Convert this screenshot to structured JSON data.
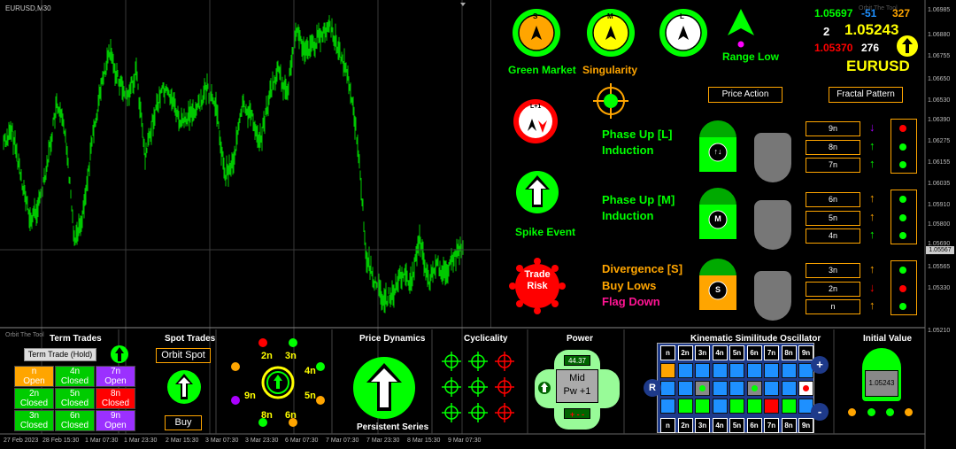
{
  "chart": {
    "symbol_tf": "EURUSD,M30",
    "price_ticks": [
      "1.06985",
      "1.06880",
      "1.06755",
      "1.06650",
      "1.06530",
      "1.06390",
      "1.06275",
      "1.06155",
      "1.06035",
      "1.05910",
      "1.05800",
      "1.05690",
      "1.05565",
      "1.05330",
      "1.05210"
    ],
    "current_price": "1.05567",
    "time_ticks": [
      "27 Feb 2023",
      "28 Feb 15:30",
      "1 Mar 07:30",
      "1 Mar 23:30",
      "2 Mar 15:30",
      "3 Mar 07:30",
      "3 Mar 23:30",
      "6 Mar 07:30",
      "7 Mar 07:30",
      "7 Mar 23:30",
      "8 Mar 15:30",
      "9 Mar 07:30"
    ]
  },
  "watermark": "Orbit The Tool",
  "watermark2": "Orbit The Tool",
  "top_circles": [
    {
      "letter": "S",
      "label": "Green Market",
      "label_color": "#00ff00",
      "fill": "#ffa500",
      "ring": "#00ff00"
    },
    {
      "letter": "M",
      "label": "Singularity",
      "label_color": "#ffa500",
      "fill": "#ffff00",
      "ring": "#00ff00"
    },
    {
      "letter": "L",
      "label": "",
      "label_color": "#00ff00",
      "fill": "#ffffff",
      "ring": "#00ff00"
    }
  ],
  "range_low": {
    "label": "Range Low"
  },
  "stats": {
    "v1": "1.05697",
    "v2": "-51",
    "v3": "327",
    "v4": "2",
    "v5": "1.05243",
    "v6": "1.05370",
    "v7": "276",
    "symbol": "EURUSD"
  },
  "price_action_btn": "Price Action",
  "fractal_btn": "Fractal Pattern",
  "lhl_badge": "L+1",
  "spike_label": "Spike Event",
  "trade_risk": "Trade Risk",
  "phase_l": {
    "line1": "Phase Up [L]",
    "line2": "Induction"
  },
  "phase_m": {
    "line1": "Phase Up [M]",
    "line2": "Induction"
  },
  "divergence": {
    "line1": "Divergence [S]",
    "line2": "Buy Lows",
    "line3": "Flag Down"
  },
  "tiles": [
    {
      "symbol": "↑↓"
    },
    {
      "symbol": "M"
    },
    {
      "symbol": "S"
    }
  ],
  "fractal_rows": [
    {
      "label": "9n",
      "arrow": "↓",
      "arrow_color": "#aa00ff",
      "dot": "#ff0000"
    },
    {
      "label": "8n",
      "arrow": "↑",
      "arrow_color": "#00ff00",
      "dot": "#00ff00"
    },
    {
      "label": "7n",
      "arrow": "↑",
      "arrow_color": "#00ff00",
      "dot": "#00ff00"
    },
    {
      "label": "6n",
      "arrow": "↑",
      "arrow_color": "#ffa500",
      "dot": "#00ff00"
    },
    {
      "label": "5n",
      "arrow": "↑",
      "arrow_color": "#ffa500",
      "dot": "#00ff00"
    },
    {
      "label": "4n",
      "arrow": "↑",
      "arrow_color": "#00ff00",
      "dot": "#00ff00"
    },
    {
      "label": "3n",
      "arrow": "↑",
      "arrow_color": "#ffa500",
      "dot": "#00ff00"
    },
    {
      "label": "2n",
      "arrow": "↓",
      "arrow_color": "#ff0000",
      "dot": "#ff0000"
    },
    {
      "label": "n",
      "arrow": "↑",
      "arrow_color": "#ffa500",
      "dot": "#00ff00"
    }
  ],
  "term_trades": {
    "title": "Term Trades",
    "hold_btn": "Term Trade (Hold)",
    "cells": [
      {
        "label": "n",
        "status": "Open",
        "bg": "#ffa500"
      },
      {
        "label": "4n",
        "status": "Closed",
        "bg": "#00cc00"
      },
      {
        "label": "7n",
        "status": "Open",
        "bg": "#9b30ff"
      },
      {
        "label": "2n",
        "status": "Closed",
        "bg": "#00cc00"
      },
      {
        "label": "5n",
        "status": "Closed",
        "bg": "#00cc00"
      },
      {
        "label": "8n",
        "status": "Closed",
        "bg": "#ff0000"
      },
      {
        "label": "3n",
        "status": "Closed",
        "bg": "#00cc00"
      },
      {
        "label": "6n",
        "status": "Closed",
        "bg": "#00cc00"
      },
      {
        "label": "9n",
        "status": "Open",
        "bg": "#9b30ff"
      }
    ]
  },
  "spot_trades": {
    "title": "Spot Trades",
    "orbit_btn": "Orbit Spot",
    "buy_btn": "Buy"
  },
  "orbit_ring": {
    "labels": [
      "2n",
      "3n",
      "4n",
      "5n",
      "6n",
      "8n",
      "9n"
    ]
  },
  "price_dynamics": {
    "title": "Price Dynamics",
    "label": "Persistent Series"
  },
  "cyclicality": {
    "title": "Cyclicality"
  },
  "power": {
    "title": "Power",
    "value": "44.37",
    "mid": "Mid",
    "pw": "Pw +1",
    "bar": "+ - -"
  },
  "kinematic": {
    "title": "Kinematic Similitude Oscillator",
    "headers": [
      "n",
      "2n",
      "3n",
      "4n",
      "5n",
      "6n",
      "7n",
      "8n",
      "9n"
    ],
    "left_btn": "R",
    "plus_btn": "+",
    "minus_btn": "-"
  },
  "initial_value": {
    "title": "Initial Value",
    "value": "1.05243"
  }
}
